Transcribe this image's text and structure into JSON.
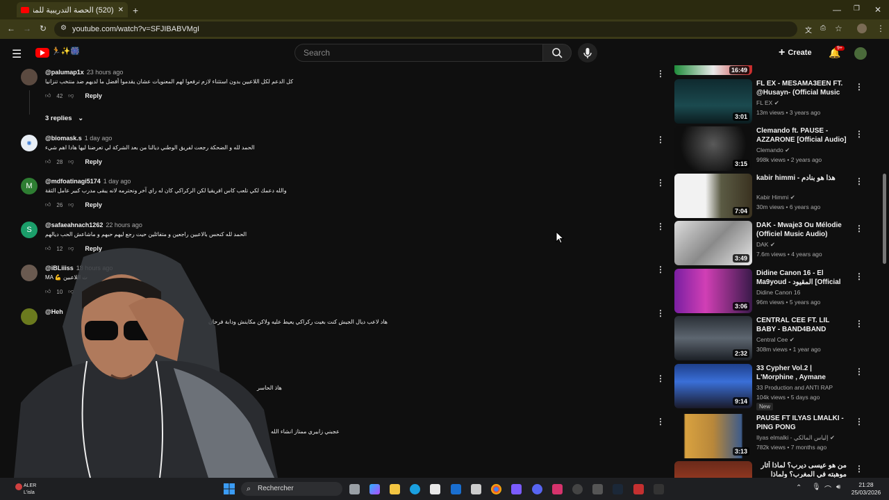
{
  "browser": {
    "tab_title": "(520) الحصة التدريبية للمنتخب الـ",
    "url": "youtube.com/watch?v=SFJIBABVMgI"
  },
  "youtube": {
    "search_placeholder": "Search",
    "create_label": "Create",
    "notif_count": "9+",
    "colors": {
      "brand": "#ff0000",
      "bg": "#0f0f0f"
    }
  },
  "comments": [
    {
      "handle": "@palumap1x",
      "time": "23 hours ago",
      "text": "كل الدعم لكل اللاعبين بدون استثناء لازم ترفعوا لهم المعنويات عشان يقدموا أفضل ما لديهم ضد منتخب تنزانيا",
      "likes": "42",
      "reply": "Reply",
      "replies": "3 replies"
    },
    {
      "handle": "@biomask.s",
      "time": "1 day ago",
      "text": "الحمد لله و الضحكة رجعت لفريق الوطني ديالنا من بعد الشركة لي تعرضنا ليها هادا اهم شيء",
      "likes": "28",
      "reply": "Reply"
    },
    {
      "handle": "@mdfoatinagi5174",
      "time": "1 day ago",
      "text": "والله دعمك لكي تلعب كاس افريقيا لكن الركراكي كان له راي آخر ونحترمه لانه يبقى مدرب كبير عامل الثقة",
      "likes": "26",
      "reply": "Reply"
    },
    {
      "handle": "@safaeahnach1262",
      "time": "22 hours ago",
      "text": "الحمد لله كنحس بالاعبين راجعين و متفائلين حيت رجع ليهم حبهم و ماشاعش الحب ديالهم",
      "likes": "12",
      "reply": "Reply"
    },
    {
      "handle": "@iBLiiiss",
      "time": "18 hours ago",
      "text": "MA 💪 ت اللاعبين",
      "likes": "10",
      "reply": ""
    },
    {
      "handle": "@Heh",
      "time": "",
      "text": "هاد لاعب ديال الجيش كنت بغيت ركراكي يعيط عليه ولاكن مكاينش ودابة فرحان",
      "likes": "",
      "reply": ""
    },
    {
      "handle": "",
      "time": "",
      "text": "هاذ الحاسر",
      "likes": "",
      "reply": ""
    },
    {
      "handle": "",
      "time": "",
      "text": "عجبني زابيري ممتاز انشاء الله",
      "likes": "",
      "reply": ""
    }
  ],
  "sidebar": [
    {
      "title": "",
      "channel": "",
      "meta": "",
      "duration": "16:49"
    },
    {
      "title": "FL EX - MESAMA3EEN FT. @Husayn- (Official Music ...",
      "channel": "FL EX",
      "meta": "13m views • 3 years ago",
      "duration": "3:01"
    },
    {
      "title": "Clemando ft. PAUSE - AZZARONE [Official Audio] ...",
      "channel": "Clemando",
      "meta": "998k views • 2 years ago",
      "duration": "3:15"
    },
    {
      "title": "kabir himmi - هذا هو بنادم",
      "channel": "Kabir Himmi",
      "meta": "30m views • 6 years ago",
      "duration": "7:04"
    },
    {
      "title": "DAK - Mwaje3 Ou Mélodie (Officiel Music Audio)(Clean) ...",
      "channel": "DAK",
      "meta": "7.6m views • 4 years ago",
      "duration": "3:49"
    },
    {
      "title": "Didine Canon 16 - El Ma9youd - المقيود [Official Music Video] #L...",
      "channel": "Didine Canon 16",
      "meta": "96m views • 5 years ago",
      "duration": "3:06"
    },
    {
      "title": "CENTRAL CEE FT. LIL BABY - BAND4BAND (MUSIC VIDEO)",
      "channel": "Central Cee",
      "meta": "308m views • 1 year ago",
      "duration": "2:32"
    },
    {
      "title": "33 Cypher Vol.2 | L'Morphine , Aymane HAQQI , Aessa , ...",
      "channel": "33 Production and ANTI RAP",
      "meta": "104k views • 5 days ago",
      "duration": "9:14",
      "badge": "New"
    },
    {
      "title": "PAUSE FT ILYAS LMALKI - PING PONG",
      "channel": "Ilyas elmalki - إلياس المالكي",
      "meta": "782k views • 7 months ago",
      "duration": "3:13"
    },
    {
      "title": "من هو عيسى ديرب؟ لماذا أثار موهبته في المغرب؟ ولماذا أسرت الجماهير على...",
      "channel": "",
      "meta": "",
      "duration": ""
    }
  ],
  "taskbar": {
    "search_label": "Rechercher",
    "time": "21:28",
    "date": "25/03/2026",
    "alert_label": "ALER",
    "alert_sub": "L'isla"
  }
}
